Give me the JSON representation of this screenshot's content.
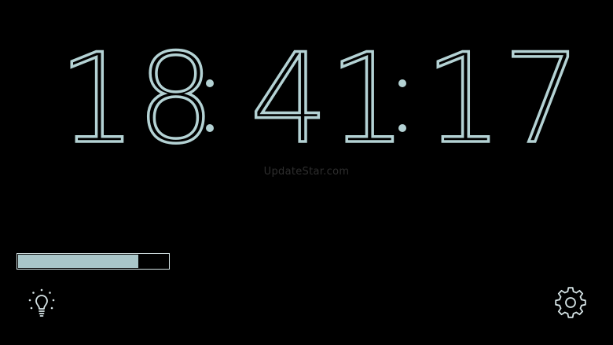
{
  "clock": {
    "hours": "18",
    "minutes": "41",
    "seconds": "17",
    "separator": ":"
  },
  "watermark": "UpdateStar.com",
  "battery": {
    "level": 0.8
  },
  "icons": {
    "light_toggle": "lightbulb-icon",
    "settings": "gear-icon"
  },
  "colors": {
    "digits": "#b4d2d4",
    "background": "#000000",
    "battery_fill": "#a9c6c9",
    "battery_border": "#d6e4e6"
  }
}
